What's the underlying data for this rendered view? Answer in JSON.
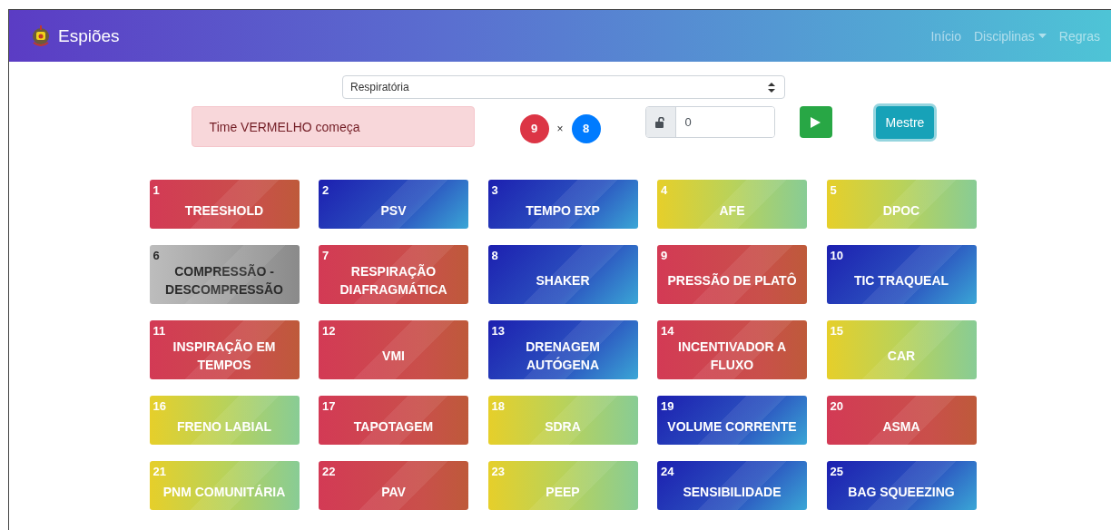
{
  "navbar": {
    "brand": "Espiões",
    "links": [
      {
        "label": "Início",
        "dropdown": false
      },
      {
        "label": "Disciplinas",
        "dropdown": true
      },
      {
        "label": "Regras",
        "dropdown": false
      }
    ]
  },
  "discipline_select": {
    "value": "Respiratória"
  },
  "alert": "Time VERMELHO começa",
  "score": {
    "red": "9",
    "separator": "×",
    "blue": "8"
  },
  "key_field": {
    "value": "0",
    "locked": false
  },
  "master_button": "Mestre",
  "cards": [
    {
      "number": "1",
      "word": "TREESHOLD",
      "kind": "red"
    },
    {
      "number": "2",
      "word": "PSV",
      "kind": "blue"
    },
    {
      "number": "3",
      "word": "TEMPO EXP",
      "kind": "blue"
    },
    {
      "number": "4",
      "word": "AFE",
      "kind": "neutral"
    },
    {
      "number": "5",
      "word": "DPOC",
      "kind": "neutral"
    },
    {
      "number": "6",
      "word": "COMPRESSÃO - DESCOMPRESSÃO",
      "kind": "assassin"
    },
    {
      "number": "7",
      "word": "RESPIRAÇÃO DIAFRAGMÁTICA",
      "kind": "red"
    },
    {
      "number": "8",
      "word": "SHAKER",
      "kind": "blue"
    },
    {
      "number": "9",
      "word": "PRESSÃO DE PLATÔ",
      "kind": "red"
    },
    {
      "number": "10",
      "word": "TIC TRAQUEAL",
      "kind": "blue"
    },
    {
      "number": "11",
      "word": "INSPIRAÇÃO EM TEMPOS",
      "kind": "red"
    },
    {
      "number": "12",
      "word": "VMI",
      "kind": "red"
    },
    {
      "number": "13",
      "word": "DRENAGEM AUTÓGENA",
      "kind": "blue"
    },
    {
      "number": "14",
      "word": "INCENTIVADOR A FLUXO",
      "kind": "red"
    },
    {
      "number": "15",
      "word": "CAR",
      "kind": "neutral"
    },
    {
      "number": "16",
      "word": "FRENO LABIAL",
      "kind": "neutral"
    },
    {
      "number": "17",
      "word": "TAPOTAGEM",
      "kind": "red"
    },
    {
      "number": "18",
      "word": "SDRA",
      "kind": "neutral"
    },
    {
      "number": "19",
      "word": "VOLUME CORRENTE",
      "kind": "blue"
    },
    {
      "number": "20",
      "word": "ASMA",
      "kind": "red"
    },
    {
      "number": "21",
      "word": "PNM COMUNITÁRIA",
      "kind": "neutral"
    },
    {
      "number": "22",
      "word": "PAV",
      "kind": "red"
    },
    {
      "number": "23",
      "word": "PEEP",
      "kind": "neutral"
    },
    {
      "number": "24",
      "word": "SENSIBILIDADE",
      "kind": "blue"
    },
    {
      "number": "25",
      "word": "BAG SQUEEZING",
      "kind": "blue"
    }
  ]
}
